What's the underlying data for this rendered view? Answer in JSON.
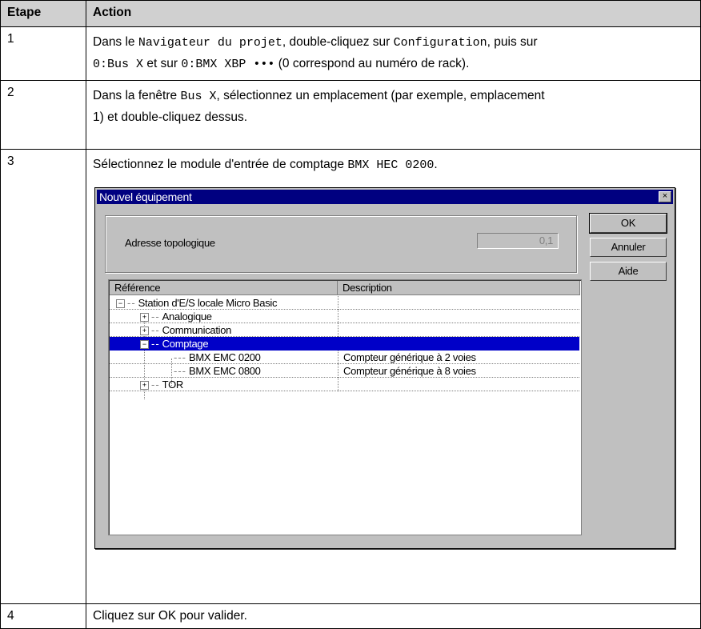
{
  "table": {
    "header_step": "Etape",
    "header_action": "Action",
    "rows": [
      {
        "step": "1",
        "t1": "Dans le ",
        "c1": "Navigateur du projet",
        "t2": ", double-cliquez sur ",
        "c2": "Configuration",
        "t3": ", puis sur",
        "c3": "0:Bus X",
        "t4": " et sur ",
        "c4": "0:BMX XBP •••",
        "t5": " (0 correspond au numéro de rack)."
      },
      {
        "step": "2",
        "t1": "Dans la fenêtre ",
        "c1": "Bus X",
        "t2": ", sélectionnez un emplacement (par exemple, emplacement",
        "t3": "1) et double-cliquez dessus."
      },
      {
        "step": "3",
        "t1": "Sélectionnez le module d'entrée de comptage ",
        "c1": "BMX HEC 0200",
        "t2": "."
      },
      {
        "step": "4",
        "t1": "Cliquez sur OK pour valider."
      }
    ]
  },
  "dialog": {
    "title": "Nouvel équipement",
    "close_glyph": "×",
    "address_label": "Adresse topologique",
    "address_value": "0,1",
    "buttons": {
      "ok": "OK",
      "cancel": "Annuler",
      "help": "Aide"
    },
    "columns": {
      "reference": "Référence",
      "description": "Description"
    },
    "tree": [
      {
        "label": "Station d'E/S locale Micro Basic",
        "toggle": "−",
        "description": ""
      },
      {
        "label": "Analogique",
        "toggle": "+",
        "description": ""
      },
      {
        "label": "Communication",
        "toggle": "+",
        "description": ""
      },
      {
        "label": "Comptage",
        "toggle": "−",
        "description": "",
        "selected": true
      },
      {
        "label": "BMX EMC 0200",
        "toggle": "",
        "description": "Compteur générique à 2 voies"
      },
      {
        "label": "BMX EMC 0800",
        "toggle": "",
        "description": "Compteur générique à 8 voies"
      },
      {
        "label": "TOR",
        "toggle": "+",
        "description": ""
      }
    ]
  }
}
